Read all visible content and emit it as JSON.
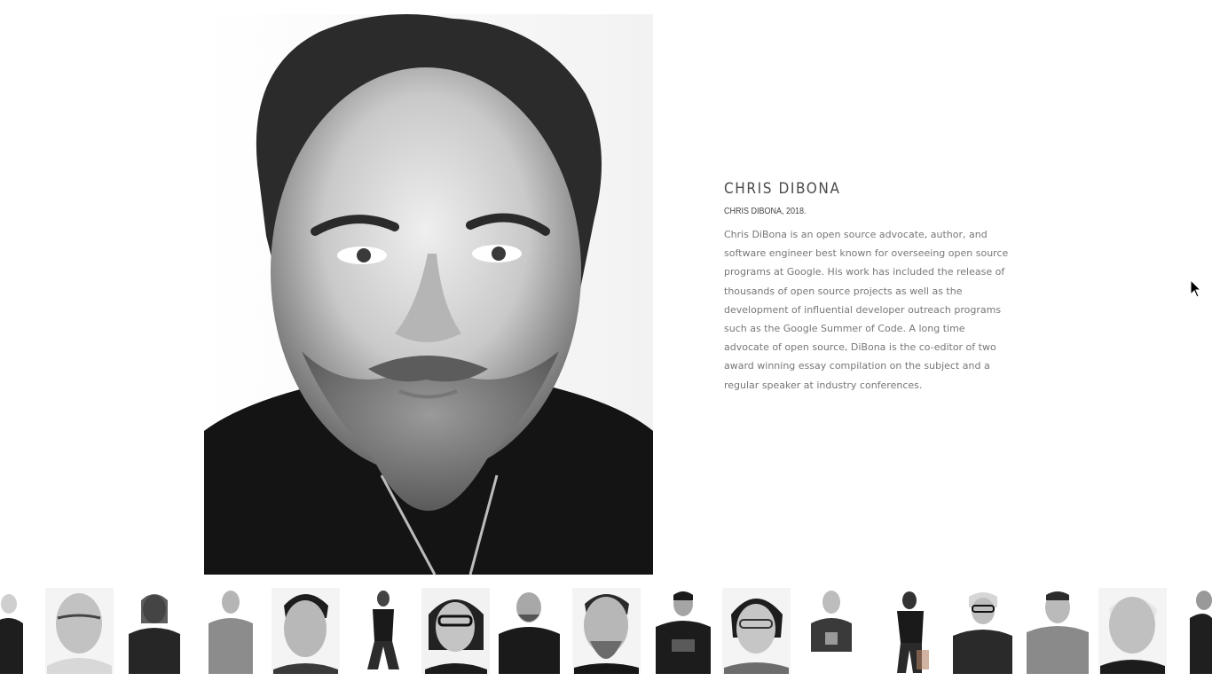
{
  "person": {
    "name": "CHRIS DIBONA",
    "caption": "CHRIS DIBONA, 2018.",
    "bio": "Chris DiBona is an open source advocate, author, and software engineer best known for overseeing open source programs at Google. His work has included the release of thousands of open source projects as well as the development of influential developer outreach programs such as the Google Summer of Code. A long time advocate of open source, DiBona is the co-editor of two award winning essay compilation on the subject and a regular speaker at industry conferences."
  },
  "gallery": {
    "thumbnail_count": 17
  }
}
